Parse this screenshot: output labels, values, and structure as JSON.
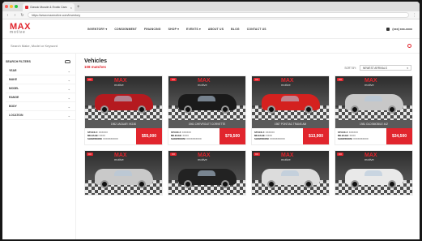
{
  "browser": {
    "tab_title": "Classic Muscle & Exotic Cars",
    "url": "https://www.maxmotive.com/inventory"
  },
  "site": {
    "logo_main": "MAX",
    "logo_sub": "motive",
    "nav": [
      "INVENTORY ▾",
      "CONSIGNMENT",
      "FINANCING",
      "SHOP ▾",
      "EVENTS ▾",
      "ABOUT US",
      "BLOG",
      "CONTACT US"
    ],
    "phone": "(xxx) xxx-xxxx"
  },
  "search": {
    "placeholder": "Search Make, Model or Keyword"
  },
  "sidebar": {
    "heading": "SEARCH FILTERS",
    "filters": [
      "YEAR",
      "MAKE",
      "MODEL",
      "RANGE",
      "BODY",
      "LOCATION"
    ]
  },
  "listing": {
    "title": "Vehicles",
    "matches": "108 matches",
    "sort_label": "SORT BY:",
    "sort_value": "NEWEST ARRIVALS"
  },
  "vehicles": [
    {
      "title": "1962 JAGUAR XK150",
      "stock": "XXXXXX",
      "mileage": "XXXX",
      "location": "XXXXXXXXXX",
      "price": "$55,000",
      "color": "#b51a1f",
      "badge": "XX"
    },
    {
      "title": "1961 CHEVROLET CORVETTE",
      "stock": "XXXXXX",
      "mileage": "XXXX",
      "location": "XXXXXXXXXX",
      "price": "$79,500",
      "color": "#1a1a1a",
      "badge": "XX"
    },
    {
      "title": "1987 PONTIAC TRANS AM",
      "stock": "XXXXXX",
      "mileage": "XXXX",
      "location": "XXXXXXXXXX",
      "price": "$13,900",
      "color": "#d4211f",
      "badge": "XX"
    },
    {
      "title": "1981 OLDSMOBILE 442",
      "stock": "XXXXXX",
      "mileage": "XXXX",
      "location": "XXXXXXXXXX",
      "price": "$34,500",
      "color": "#c8c8c8",
      "badge": "XX"
    },
    {
      "title": "",
      "stock": "",
      "mileage": "",
      "location": "",
      "price": "",
      "color": "#c9c9c9",
      "badge": "XX"
    },
    {
      "title": "",
      "stock": "",
      "mileage": "",
      "location": "",
      "price": "",
      "color": "#222222",
      "badge": "XX"
    },
    {
      "title": "",
      "stock": "",
      "mileage": "",
      "location": "",
      "price": "",
      "color": "#dcdcdc",
      "badge": "XX"
    },
    {
      "title": "",
      "stock": "",
      "mileage": "",
      "location": "",
      "price": "",
      "color": "#e9e9e9",
      "badge": "XX"
    }
  ],
  "labels": {
    "stock": "STOCK #:",
    "mileage": "MILEAGE:",
    "location": "SHOWROOM:"
  },
  "colors": {
    "accent": "#e1252d"
  }
}
